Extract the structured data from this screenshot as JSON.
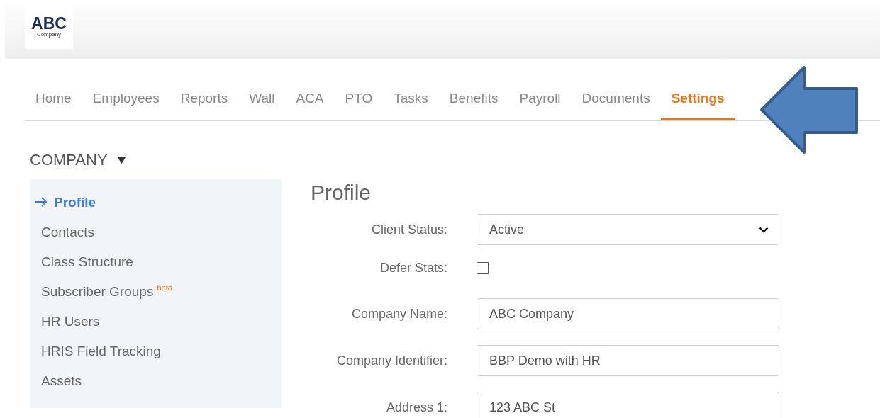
{
  "logo": {
    "title": "ABC",
    "subtitle": "Company"
  },
  "tabs": [
    {
      "label": "Home",
      "selected": false
    },
    {
      "label": "Employees",
      "selected": false
    },
    {
      "label": "Reports",
      "selected": false
    },
    {
      "label": "Wall",
      "selected": false
    },
    {
      "label": "ACA",
      "selected": false
    },
    {
      "label": "PTO",
      "selected": false
    },
    {
      "label": "Tasks",
      "selected": false
    },
    {
      "label": "Benefits",
      "selected": false
    },
    {
      "label": "Payroll",
      "selected": false
    },
    {
      "label": "Documents",
      "selected": false
    },
    {
      "label": "Settings",
      "selected": true
    }
  ],
  "sidebar": {
    "title": "COMPANY",
    "items": [
      {
        "label": "Profile",
        "selected": true
      },
      {
        "label": "Contacts",
        "selected": false
      },
      {
        "label": "Class Structure",
        "selected": false
      },
      {
        "label": "Subscriber Groups",
        "badge": "beta",
        "selected": false
      },
      {
        "label": "HR Users",
        "selected": false
      },
      {
        "label": "HRIS Field Tracking",
        "selected": false
      },
      {
        "label": "Assets",
        "selected": false
      }
    ]
  },
  "form": {
    "title": "Profile",
    "fields": [
      {
        "kind": "select",
        "label": "Client Status:",
        "value": "Active"
      },
      {
        "kind": "checkbox",
        "label": "Defer Stats:",
        "checked": false
      },
      {
        "kind": "text",
        "label": "Company Name:",
        "value": "ABC Company"
      },
      {
        "kind": "text",
        "label": "Company Identifier:",
        "value": "BBP Demo with HR"
      },
      {
        "kind": "text",
        "label": "Address 1:",
        "value": "123 ABC St"
      }
    ]
  }
}
